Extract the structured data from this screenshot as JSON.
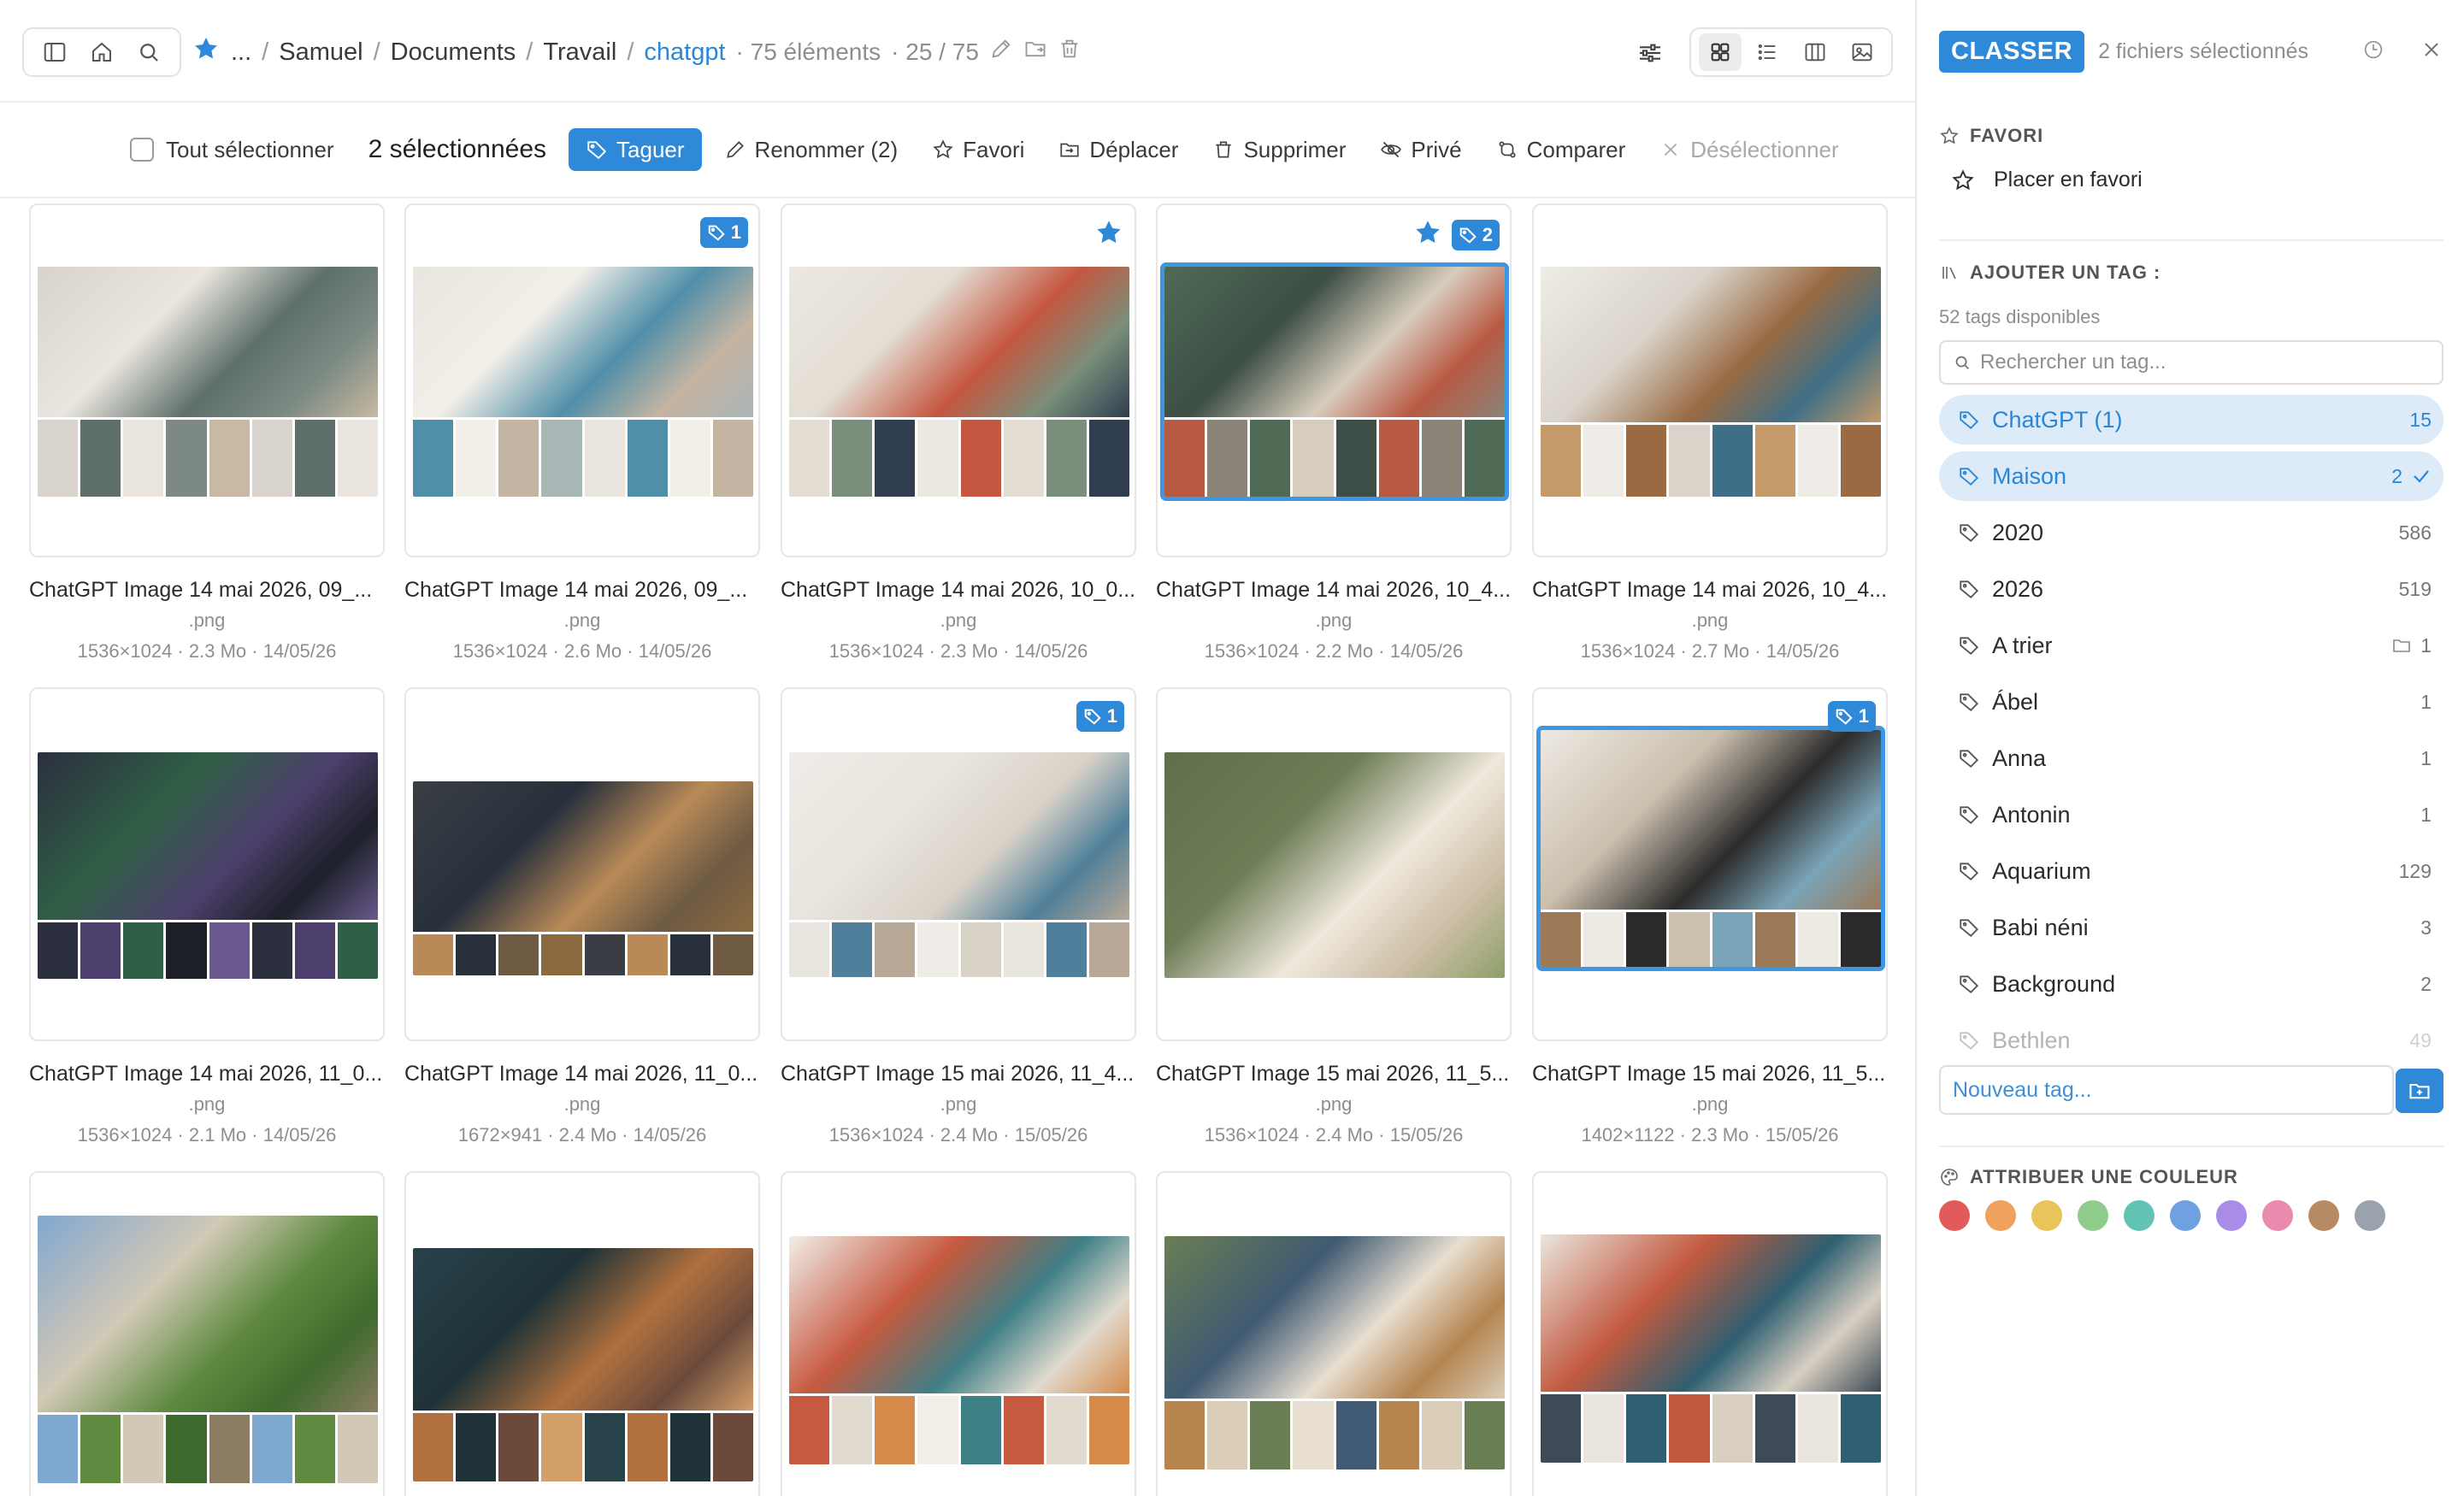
{
  "topbar": {
    "breadcrumb": {
      "ellipsis": "...",
      "segments": [
        "Samuel",
        "Documents",
        "Travail"
      ],
      "current": "chatgpt",
      "count": "· 75 éléments",
      "page": "· 25 / 75"
    }
  },
  "actionbar": {
    "select_all": "Tout sélectionner",
    "selected": "2 sélectionnées",
    "tag": "Taguer",
    "rename": "Renommer (2)",
    "favorite": "Favori",
    "move": "Déplacer",
    "delete": "Supprimer",
    "private": "Privé",
    "compare": "Comparer",
    "deselect": "Désélectionner"
  },
  "files": [
    {
      "name": "ChatGPT Image 14 mai 2026, 09_...",
      "ext": ".png",
      "info": "1536×1024 · 2.3 Mo · 14/05/26",
      "star": false,
      "tags": "",
      "selected": false,
      "palette": [
        "#d8d3cc",
        "#5e6f6a",
        "#eae6df",
        "#7c8a83",
        "#c9b9a2"
      ]
    },
    {
      "name": "ChatGPT Image 14 mai 2026, 09_...",
      "ext": ".png",
      "info": "1536×1024 · 2.6 Mo · 14/05/26",
      "star": false,
      "tags": "1",
      "selected": false,
      "palette": [
        "#e9e6e0",
        "#4f8fa8",
        "#f2efe9",
        "#c4b4a2",
        "#a9b7b6"
      ]
    },
    {
      "name": "ChatGPT Image 14 mai 2026, 10_0...",
      "ext": ".png",
      "info": "1536×1024 · 2.3 Mo · 14/05/26",
      "star": true,
      "tags": "",
      "selected": false,
      "palette": [
        "#ece8e2",
        "#c5563f",
        "#e3ddd3",
        "#7a8f7b",
        "#2f3d4f"
      ]
    },
    {
      "name": "ChatGPT Image 14 mai 2026, 10_4...",
      "ext": ".png",
      "info": "1536×1024 · 2.2 Mo · 14/05/26",
      "star": true,
      "tags": "2",
      "selected": true,
      "palette": [
        "#4f6b55",
        "#d8cdbd",
        "#3c4e45",
        "#b85a43",
        "#8a8478"
      ]
    },
    {
      "name": "ChatGPT Image 14 mai 2026, 10_4...",
      "ext": ".png",
      "info": "1536×1024 · 2.7 Mo · 14/05/26",
      "star": false,
      "tags": "",
      "selected": false,
      "palette": [
        "#efece7",
        "#9a6b43",
        "#d9d3ca",
        "#3f6f86",
        "#c59a6b"
      ]
    },
    {
      "name": "ChatGPT Image 14 mai 2026, 11_0...",
      "ext": ".png",
      "info": "1536×1024 · 2.1 Mo · 14/05/26",
      "star": false,
      "tags": "",
      "selected": false,
      "palette": [
        "#2b2f3e",
        "#4d3f6c",
        "#2f5f46",
        "#1d2029",
        "#6a5a8f"
      ]
    },
    {
      "name": "ChatGPT Image 14 mai 2026, 11_0...",
      "ext": ".png",
      "info": "1672×941 · 2.4 Mo · 14/05/26",
      "star": false,
      "tags": "",
      "selected": false,
      "palette": [
        "#3a3e44",
        "#b98a57",
        "#27303b",
        "#6e5a43",
        "#8c6a40"
      ]
    },
    {
      "name": "ChatGPT Image 15 mai 2026, 11_4...",
      "ext": ".png",
      "info": "1536×1024 · 2.4 Mo · 15/05/26",
      "star": false,
      "tags": "1",
      "selected": false,
      "palette": [
        "#f0ede8",
        "#d9d2c7",
        "#e8e4de",
        "#4f7f9a",
        "#b7a996"
      ]
    },
    {
      "name": "ChatGPT Image 15 mai 2026, 11_5...",
      "ext": ".png",
      "info": "1536×1024 · 2.4 Mo · 15/05/26",
      "star": false,
      "tags": "",
      "selected": false,
      "palette": [
        "#5f6f4b",
        "#efe8dc",
        "#6d7d56",
        "#cdbfa7",
        "#8f9f6a"
      ]
    },
    {
      "name": "ChatGPT Image 15 mai 2026, 11_5...",
      "ext": ".png",
      "info": "1402×1122 · 2.3 Mo · 15/05/26",
      "star": false,
      "tags": "1",
      "selected": true,
      "palette": [
        "#ede9e3",
        "#2b2b2b",
        "#cbbfae",
        "#7aa4b7",
        "#9c7a58"
      ]
    },
    {
      "name": "",
      "ext": "",
      "info": "",
      "star": false,
      "tags": "",
      "selected": false,
      "palette": [
        "#7fa8d0",
        "#5f8a3f",
        "#d2c8b5",
        "#3f6a2d",
        "#8b7d62"
      ]
    },
    {
      "name": "",
      "ext": "",
      "info": "",
      "star": false,
      "tags": "",
      "selected": false,
      "palette": [
        "#28424a",
        "#b0703f",
        "#1f3238",
        "#6b4a3c",
        "#d39f6a"
      ]
    },
    {
      "name": "",
      "ext": "",
      "info": "",
      "star": false,
      "tags": "",
      "selected": false,
      "palette": [
        "#f2eee8",
        "#3f7f86",
        "#c65a3f",
        "#e1dace",
        "#d58a4a"
      ]
    },
    {
      "name": "",
      "ext": "",
      "info": "",
      "star": false,
      "tags": "",
      "selected": false,
      "palette": [
        "#6a7e53",
        "#e8dfd0",
        "#3f5a72",
        "#b5844f",
        "#d9cdb8"
      ]
    },
    {
      "name": "",
      "ext": "",
      "info": "",
      "star": false,
      "tags": "",
      "selected": false,
      "palette": [
        "#eae6df",
        "#2f5f70",
        "#c25a3f",
        "#d8cfc1",
        "#3e4b57"
      ]
    }
  ],
  "panel": {
    "classer": "CLASSER",
    "selected": "2 fichiers sélectionnés",
    "favori_title": "FAVORI",
    "favori_action": "Placer en favori",
    "tags_title": "AJOUTER UN TAG :",
    "available": "52 tags disponibles",
    "search_placeholder": "Rechercher un tag...",
    "new_tag_placeholder": "Nouveau tag...",
    "color_title": "ATTRIBUER UNE COULEUR",
    "tags": [
      {
        "name": "ChatGPT (1)",
        "count": "15",
        "active": true,
        "check": false,
        "folder": false
      },
      {
        "name": "Maison",
        "count": "2",
        "active": true,
        "check": true,
        "folder": false
      },
      {
        "name": "2020",
        "count": "586",
        "active": false,
        "check": false,
        "folder": false
      },
      {
        "name": "2026",
        "count": "519",
        "active": false,
        "check": false,
        "folder": false
      },
      {
        "name": "A trier",
        "count": "1",
        "active": false,
        "check": false,
        "folder": true
      },
      {
        "name": "Ábel",
        "count": "1",
        "active": false,
        "check": false,
        "folder": false
      },
      {
        "name": "Anna",
        "count": "1",
        "active": false,
        "check": false,
        "folder": false
      },
      {
        "name": "Antonin",
        "count": "1",
        "active": false,
        "check": false,
        "folder": false
      },
      {
        "name": "Aquarium",
        "count": "129",
        "active": false,
        "check": false,
        "folder": false
      },
      {
        "name": "Babi néni",
        "count": "3",
        "active": false,
        "check": false,
        "folder": false
      },
      {
        "name": "Background",
        "count": "2",
        "active": false,
        "check": false,
        "folder": false
      },
      {
        "name": "Bethlen",
        "count": "49",
        "active": false,
        "check": false,
        "folder": false
      }
    ],
    "colors": [
      "#e25b5b",
      "#f0a15b",
      "#e8c45a",
      "#8fcb8a",
      "#62c3b4",
      "#6fa0df",
      "#a98be8",
      "#e98aae",
      "#b88a63",
      "#9aa3ad"
    ]
  },
  "icons": {
    "sidebar": "sidebar-icon",
    "home": "home-icon",
    "search": "search-icon",
    "star": "star-icon",
    "edit": "pencil-icon",
    "folder": "folder-icon",
    "trash": "trash-icon",
    "filter": "sliders-icon",
    "grid": "grid-icon",
    "list": "list-icon",
    "columns": "columns-icon",
    "image": "image-icon"
  }
}
